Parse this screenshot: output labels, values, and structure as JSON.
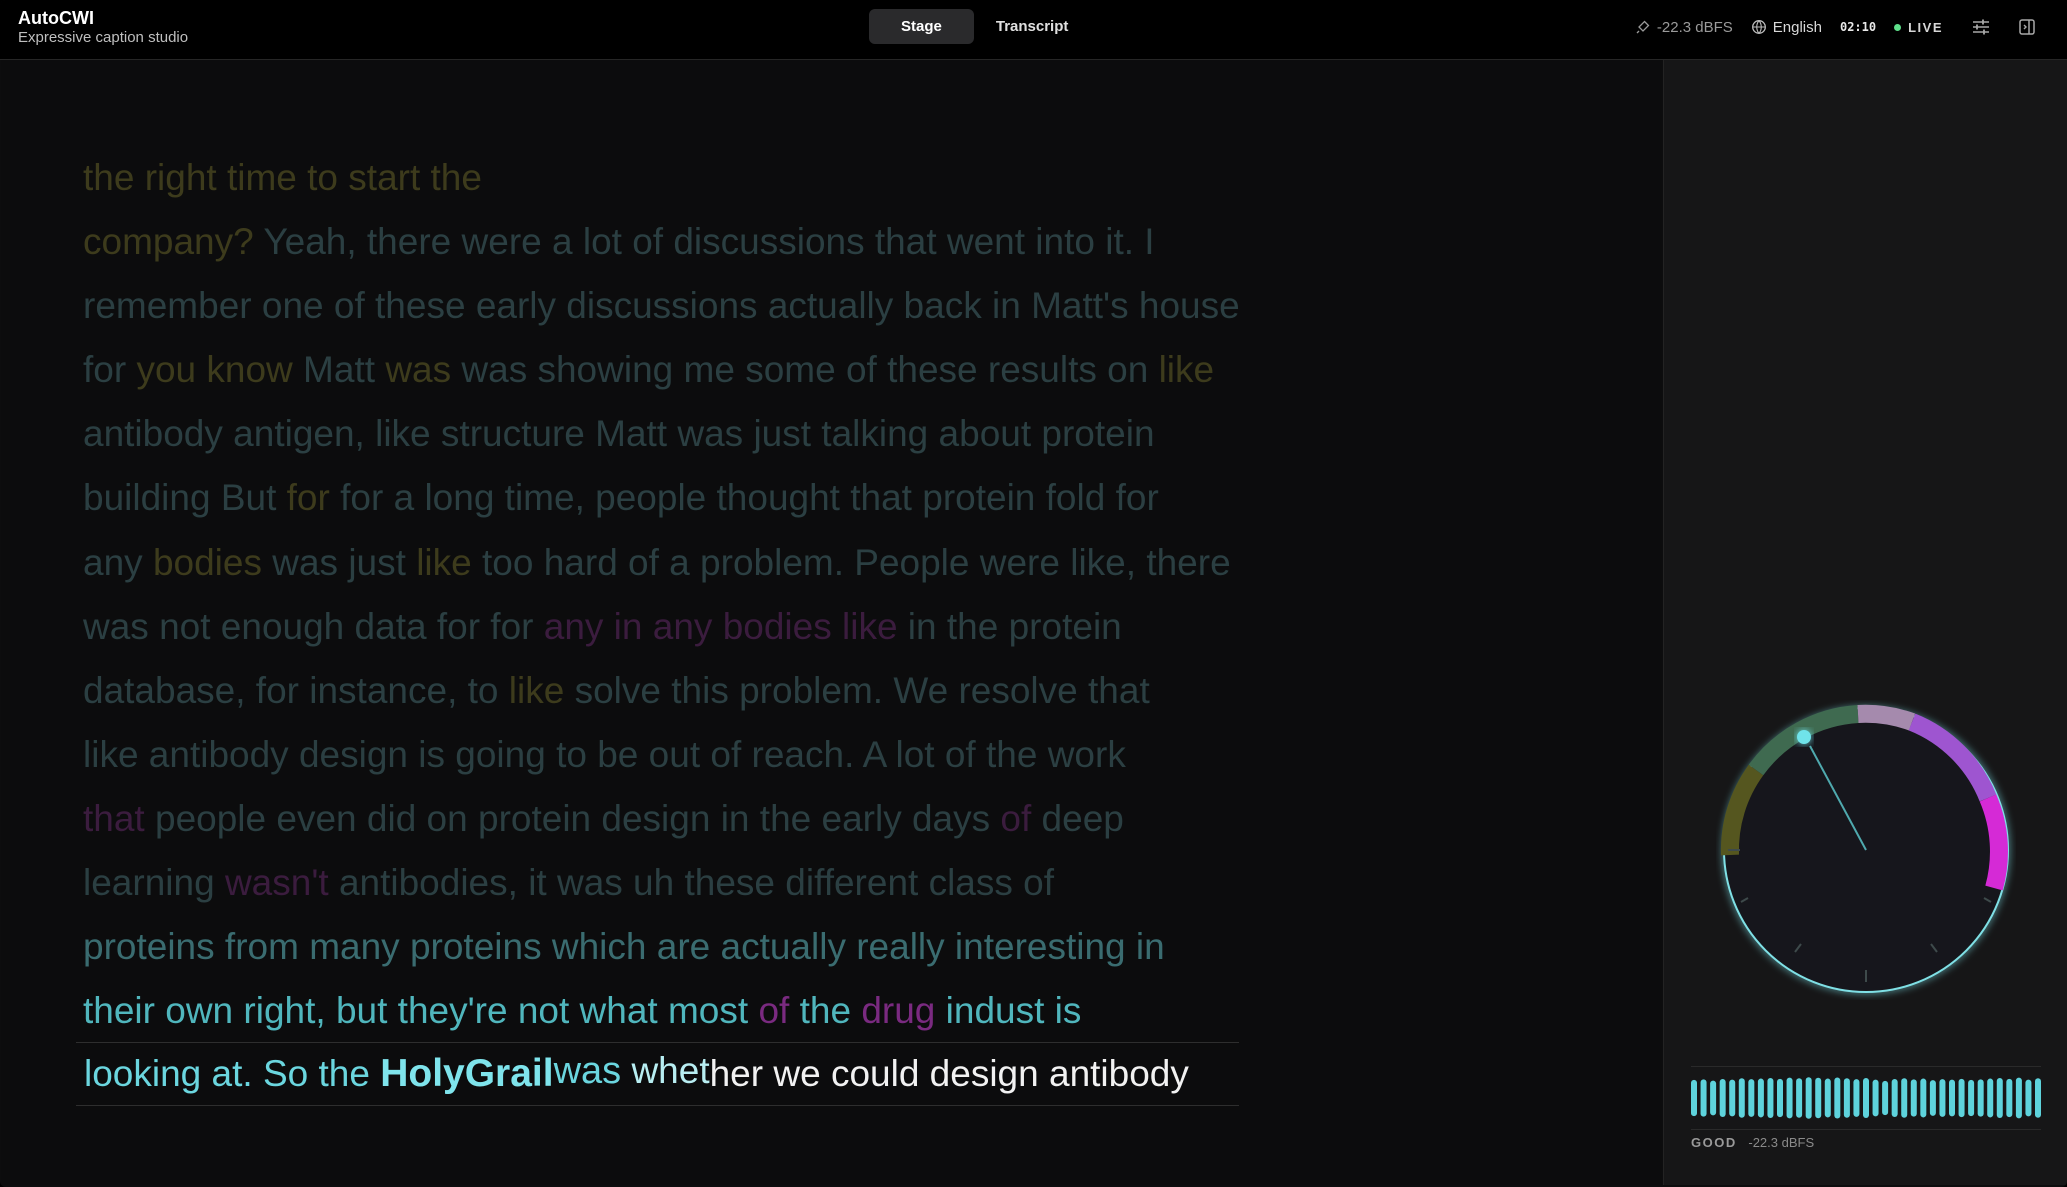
{
  "app": {
    "name": "AutoCWI",
    "subtitle": "Expressive caption studio"
  },
  "tabs": [
    {
      "label": "Stage",
      "active": true
    },
    {
      "label": "Transcript",
      "active": false
    }
  ],
  "status": {
    "input_level": "-22.3 dBFS",
    "language": "English",
    "elapsed": "02:10",
    "live_label": "LIVE"
  },
  "colors": {
    "accent": "#5ed3dc",
    "live": "#5ee08a",
    "purple": "#b84ad6",
    "magenta": "#d62ad6"
  },
  "captions": {
    "lines": [
      [
        {
          "t": "the right time to start the",
          "c": "olive"
        }
      ],
      [
        {
          "t": "company?",
          "c": "olive"
        },
        {
          "t": " Yeah, there were a lot of discussions that went into it. I",
          "c": "dim"
        }
      ],
      [
        {
          "t": "remember one of these early discussions actually back in Matt's house",
          "c": "dim"
        }
      ],
      [
        {
          "t": "for ",
          "c": "dim"
        },
        {
          "t": "you know",
          "c": "olive"
        },
        {
          "t": " Matt ",
          "c": "dim"
        },
        {
          "t": "was",
          "c": "olive"
        },
        {
          "t": " was showing me some of these results on ",
          "c": "dim"
        },
        {
          "t": "like",
          "c": "olive"
        }
      ],
      [
        {
          "t": "antibody antigen, like structure Matt was just talking about protein",
          "c": "dim"
        }
      ],
      [
        {
          "t": "building But ",
          "c": "dim"
        },
        {
          "t": "for",
          "c": "olive"
        },
        {
          "t": " for a long time, people thought that protein fold for",
          "c": "dim"
        }
      ],
      [
        {
          "t": "any ",
          "c": "dim"
        },
        {
          "t": "bodies",
          "c": "olive"
        },
        {
          "t": " was just ",
          "c": "dim"
        },
        {
          "t": "like",
          "c": "olive"
        },
        {
          "t": " too hard of a problem. People were like, there",
          "c": "dim"
        }
      ],
      [
        {
          "t": "was not enough data for for ",
          "c": "dim"
        },
        {
          "t": "any in any bodies like",
          "c": "purple"
        },
        {
          "t": " in the protein",
          "c": "dim"
        }
      ],
      [
        {
          "t": "database, for instance, to ",
          "c": "dim"
        },
        {
          "t": "like",
          "c": "olive"
        },
        {
          "t": " solve this problem. We resolve that",
          "c": "dim"
        }
      ],
      [
        {
          "t": "like antibody design is going to be out of reach. A lot of the work",
          "c": "dim"
        }
      ],
      [
        {
          "t": "that",
          "c": "purple"
        },
        {
          "t": " people even did on protein design in the early days ",
          "c": "dim"
        },
        {
          "t": "of",
          "c": "purple"
        },
        {
          "t": " deep",
          "c": "dim"
        }
      ],
      [
        {
          "t": "learning ",
          "c": "dim"
        },
        {
          "t": "wasn't",
          "c": "purple"
        },
        {
          "t": " antibodies, it was uh these different class of",
          "c": "dim"
        }
      ],
      [
        {
          "t": "proteins from many proteins which are actually really interesting in",
          "c": "mid"
        }
      ],
      [
        {
          "t": "their own right, but they're not what most ",
          "c": "bright"
        },
        {
          "t": "of",
          "c": "purple2"
        },
        {
          "t": " the ",
          "c": "bright"
        },
        {
          "t": "drug",
          "c": "purple2"
        },
        {
          "t": " indust is",
          "c": "bright"
        }
      ]
    ],
    "current": {
      "lead": "looking at. So the ",
      "holy": "Holy",
      "grail": "Grail",
      "was": "was",
      "whet": " whet",
      "her": "her",
      "rest": " we could design antibody"
    }
  },
  "meter": {
    "quality": "GOOD",
    "level": "-22.3 dBFS",
    "bars": [
      0.78,
      0.82,
      0.72,
      0.85,
      0.8,
      0.9,
      0.84,
      0.88,
      0.92,
      0.86,
      0.95,
      0.9,
      0.98,
      0.94,
      0.88,
      0.96,
      0.9,
      0.84,
      0.92,
      0.8,
      0.7,
      0.85,
      0.9,
      0.82,
      0.88,
      0.76,
      0.84,
      0.8,
      0.86,
      0.78,
      0.82,
      0.88,
      0.92,
      0.86,
      0.95,
      0.8,
      0.9
    ]
  }
}
